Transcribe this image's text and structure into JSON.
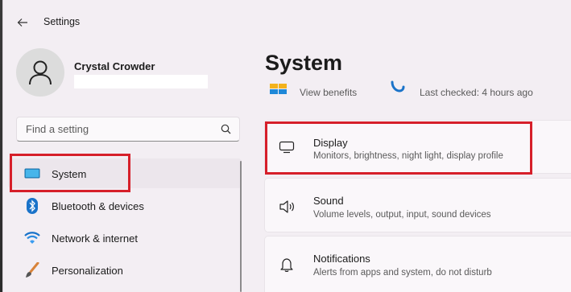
{
  "window": {
    "title": "Settings"
  },
  "profile": {
    "name": "Crystal Crowder"
  },
  "search": {
    "placeholder": "Find a setting"
  },
  "sidebar": {
    "items": [
      {
        "label": "System",
        "icon": "system-icon",
        "selected": true
      },
      {
        "label": "Bluetooth & devices",
        "icon": "bluetooth-icon",
        "selected": false
      },
      {
        "label": "Network & internet",
        "icon": "wifi-icon",
        "selected": false
      },
      {
        "label": "Personalization",
        "icon": "brush-icon",
        "selected": false
      }
    ]
  },
  "main": {
    "title": "System",
    "status": {
      "view_benefits": "View benefits",
      "last_checked": "Last checked: 4 hours ago"
    },
    "cards": [
      {
        "title": "Display",
        "subtitle": "Monitors, brightness, night light, display profile",
        "icon": "monitor-icon"
      },
      {
        "title": "Sound",
        "subtitle": "Volume levels, output, input, sound devices",
        "icon": "speaker-icon"
      },
      {
        "title": "Notifications",
        "subtitle": "Alerts from apps and system, do not disturb",
        "icon": "bell-icon"
      }
    ]
  },
  "colors": {
    "accent": "#1a5fb4",
    "highlight": "#d61f2a",
    "window_bg": "#f3eef3"
  }
}
